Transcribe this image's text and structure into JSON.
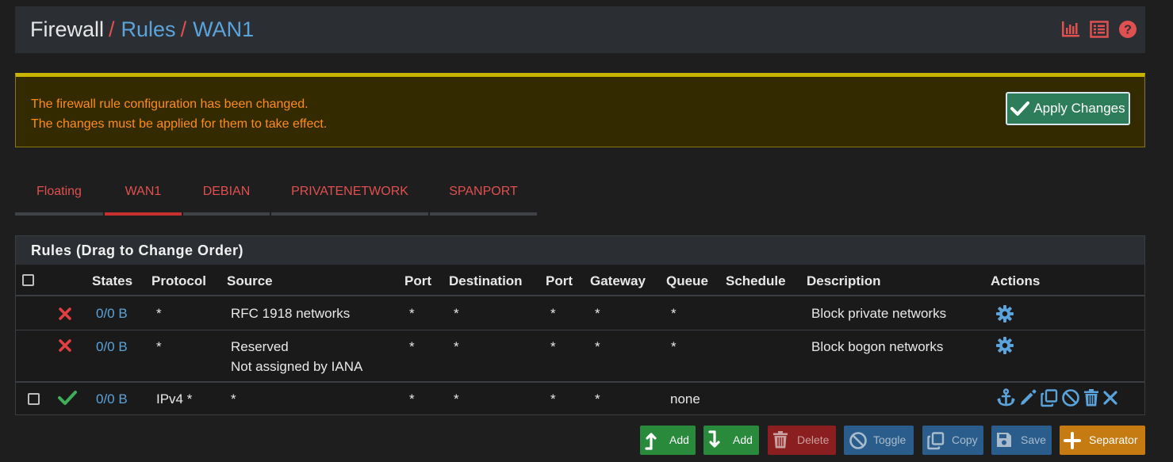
{
  "breadcrumb": {
    "root": "Firewall",
    "sep": "/",
    "items": [
      "Rules",
      "WAN1"
    ]
  },
  "header_icons": [
    "bar-chart-icon",
    "list-icon",
    "help-icon"
  ],
  "alert": {
    "line1": "The firewall rule configuration has been changed.",
    "line2": "The changes must be applied for them to take effect.",
    "apply_label": "Apply Changes"
  },
  "tabs": [
    {
      "label": "Floating",
      "active": false
    },
    {
      "label": "WAN1",
      "active": true
    },
    {
      "label": "DEBIAN",
      "active": false
    },
    {
      "label": "PRIVATENETWORK",
      "active": false
    },
    {
      "label": "SPANPORT",
      "active": false
    }
  ],
  "rules": {
    "title": "Rules (Drag to Change Order)",
    "columns": [
      "States",
      "Protocol",
      "Source",
      "Port",
      "Destination",
      "Port",
      "Gateway",
      "Queue",
      "Schedule",
      "Description",
      "Actions"
    ],
    "rows": [
      {
        "status": "block",
        "states": "0/0 B",
        "protocol": "*",
        "source": "RFC 1918 networks",
        "source2": "",
        "port": "*",
        "destination": "*",
        "dport": "*",
        "gateway": "*",
        "queue": "*",
        "schedule": "",
        "description": "Block private networks"
      },
      {
        "status": "block",
        "states": "0/0 B",
        "protocol": "*",
        "source": "Reserved",
        "source2": "Not assigned by IANA",
        "port": "*",
        "destination": "*",
        "dport": "*",
        "gateway": "*",
        "queue": "*",
        "schedule": "",
        "description": "Block bogon networks"
      },
      {
        "status": "pass",
        "states": "0/0 B",
        "protocol": "IPv4 *",
        "source": "*",
        "source2": "",
        "port": "*",
        "destination": "*",
        "dport": "*",
        "gateway": "*",
        "queue": "none",
        "schedule": "",
        "description": ""
      }
    ]
  },
  "buttons": {
    "add_top": "Add",
    "add_bottom": "Add",
    "delete": "Delete",
    "toggle": "Toggle",
    "copy": "Copy",
    "save": "Save",
    "separator": "Separator"
  },
  "colors": {
    "accent_red": "#e05050",
    "link_blue": "#5ba3db",
    "alert_text": "#ff8c1a",
    "success": "#2e7d5a",
    "add_green": "#2a8a3c",
    "delete_red": "#8b1e1e",
    "toggle_blue": "#2b5d8c",
    "separator_orange": "#c57a12"
  }
}
